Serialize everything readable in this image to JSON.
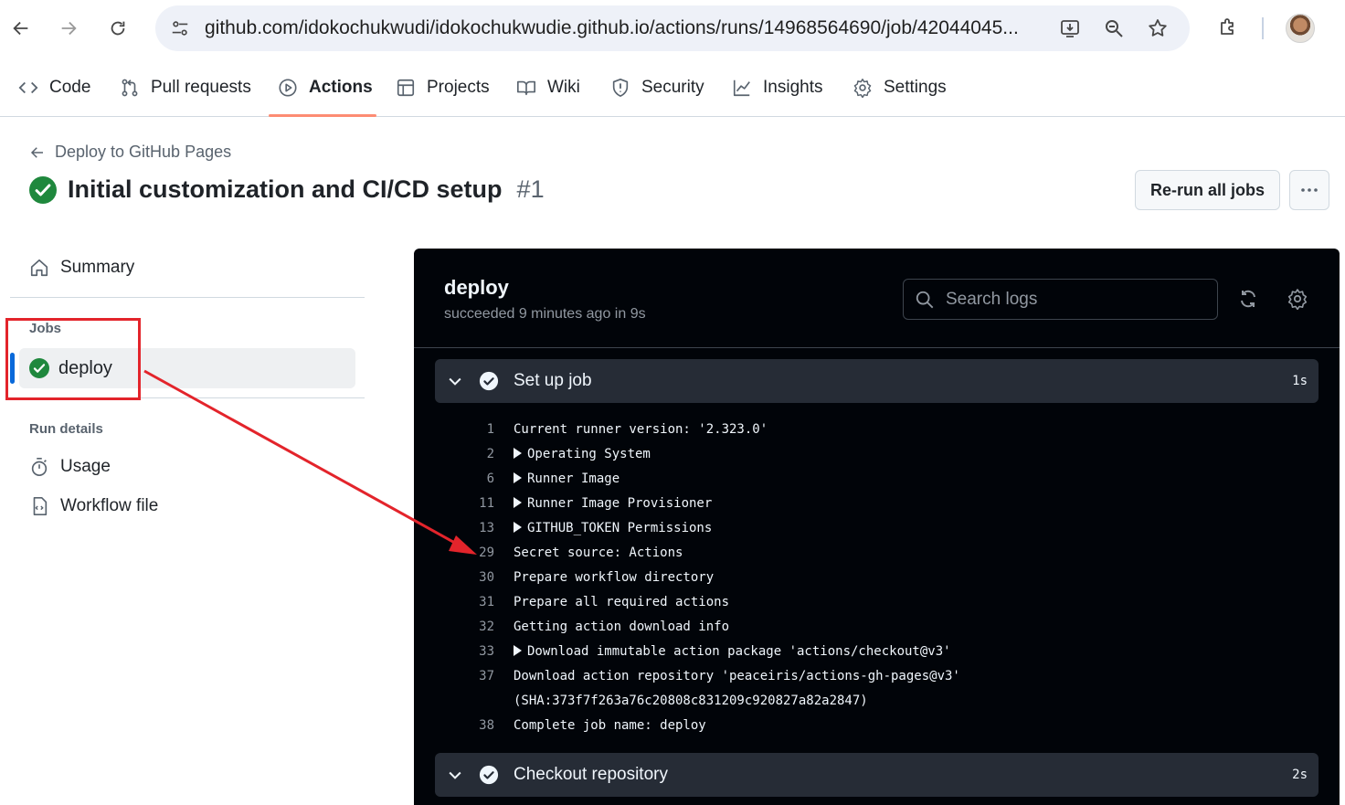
{
  "browser": {
    "url": "github.com/idokochukwudi/idokochukwudie.github.io/actions/runs/14968564690/job/42044045...",
    "buttons": [
      "back",
      "forward",
      "reload"
    ],
    "omnibox_icons": [
      "site-info-icon",
      "install-icon",
      "zoom-icon",
      "bookmark-star-icon"
    ],
    "extensions_icon": "puzzle-icon"
  },
  "repo_nav": {
    "tabs": [
      {
        "label": "Code",
        "icon": "code-icon"
      },
      {
        "label": "Pull requests",
        "icon": "pull-request-icon"
      },
      {
        "label": "Actions",
        "icon": "play-icon",
        "active": true
      },
      {
        "label": "Projects",
        "icon": "table-icon"
      },
      {
        "label": "Wiki",
        "icon": "book-icon"
      },
      {
        "label": "Security",
        "icon": "shield-icon"
      },
      {
        "label": "Insights",
        "icon": "graph-icon"
      },
      {
        "label": "Settings",
        "icon": "gear-icon"
      }
    ],
    "active_color": "#fd8c73"
  },
  "header": {
    "back_label": "Deploy to GitHub Pages",
    "title": "Initial customization and CI/CD setup",
    "run_number": "#1",
    "rerun_label": "Re-run all jobs",
    "more_label": "···",
    "status_color": "#1f883d"
  },
  "sidebar": {
    "summary_label": "Summary",
    "jobs_heading": "Jobs",
    "job_label": "deploy",
    "run_details_heading": "Run details",
    "usage_label": "Usage",
    "workflow_label": "Workflow file"
  },
  "log": {
    "job_title": "deploy",
    "job_subtitle": "succeeded 9 minutes ago in 9s",
    "search_placeholder": "Search logs",
    "steps": [
      {
        "name": "Set up job",
        "duration": "1s"
      },
      {
        "name": "Checkout repository",
        "duration": "2s"
      }
    ],
    "lines": [
      {
        "num": "1",
        "text": "Current runner version: '2.323.0'",
        "expandable": false
      },
      {
        "num": "2",
        "text": "Operating System",
        "expandable": true
      },
      {
        "num": "6",
        "text": "Runner Image",
        "expandable": true
      },
      {
        "num": "11",
        "text": "Runner Image Provisioner",
        "expandable": true
      },
      {
        "num": "13",
        "text": "GITHUB_TOKEN Permissions",
        "expandable": true
      },
      {
        "num": "29",
        "text": "Secret source: Actions",
        "expandable": false
      },
      {
        "num": "30",
        "text": "Prepare workflow directory",
        "expandable": false
      },
      {
        "num": "31",
        "text": "Prepare all required actions",
        "expandable": false
      },
      {
        "num": "32",
        "text": "Getting action download info",
        "expandable": false
      },
      {
        "num": "33",
        "text": "Download immutable action package 'actions/checkout@v3'",
        "expandable": true
      },
      {
        "num": "37",
        "text": "Download action repository 'peaceiris/actions-gh-pages@v3'",
        "expandable": false
      },
      {
        "num": "",
        "text": "(SHA:373f7f263a76c20808c831209c920827a82a2847)",
        "expandable": false
      },
      {
        "num": "38",
        "text": "Complete job name: deploy",
        "expandable": false
      }
    ]
  },
  "annotation": {
    "color": "#e3242b"
  }
}
